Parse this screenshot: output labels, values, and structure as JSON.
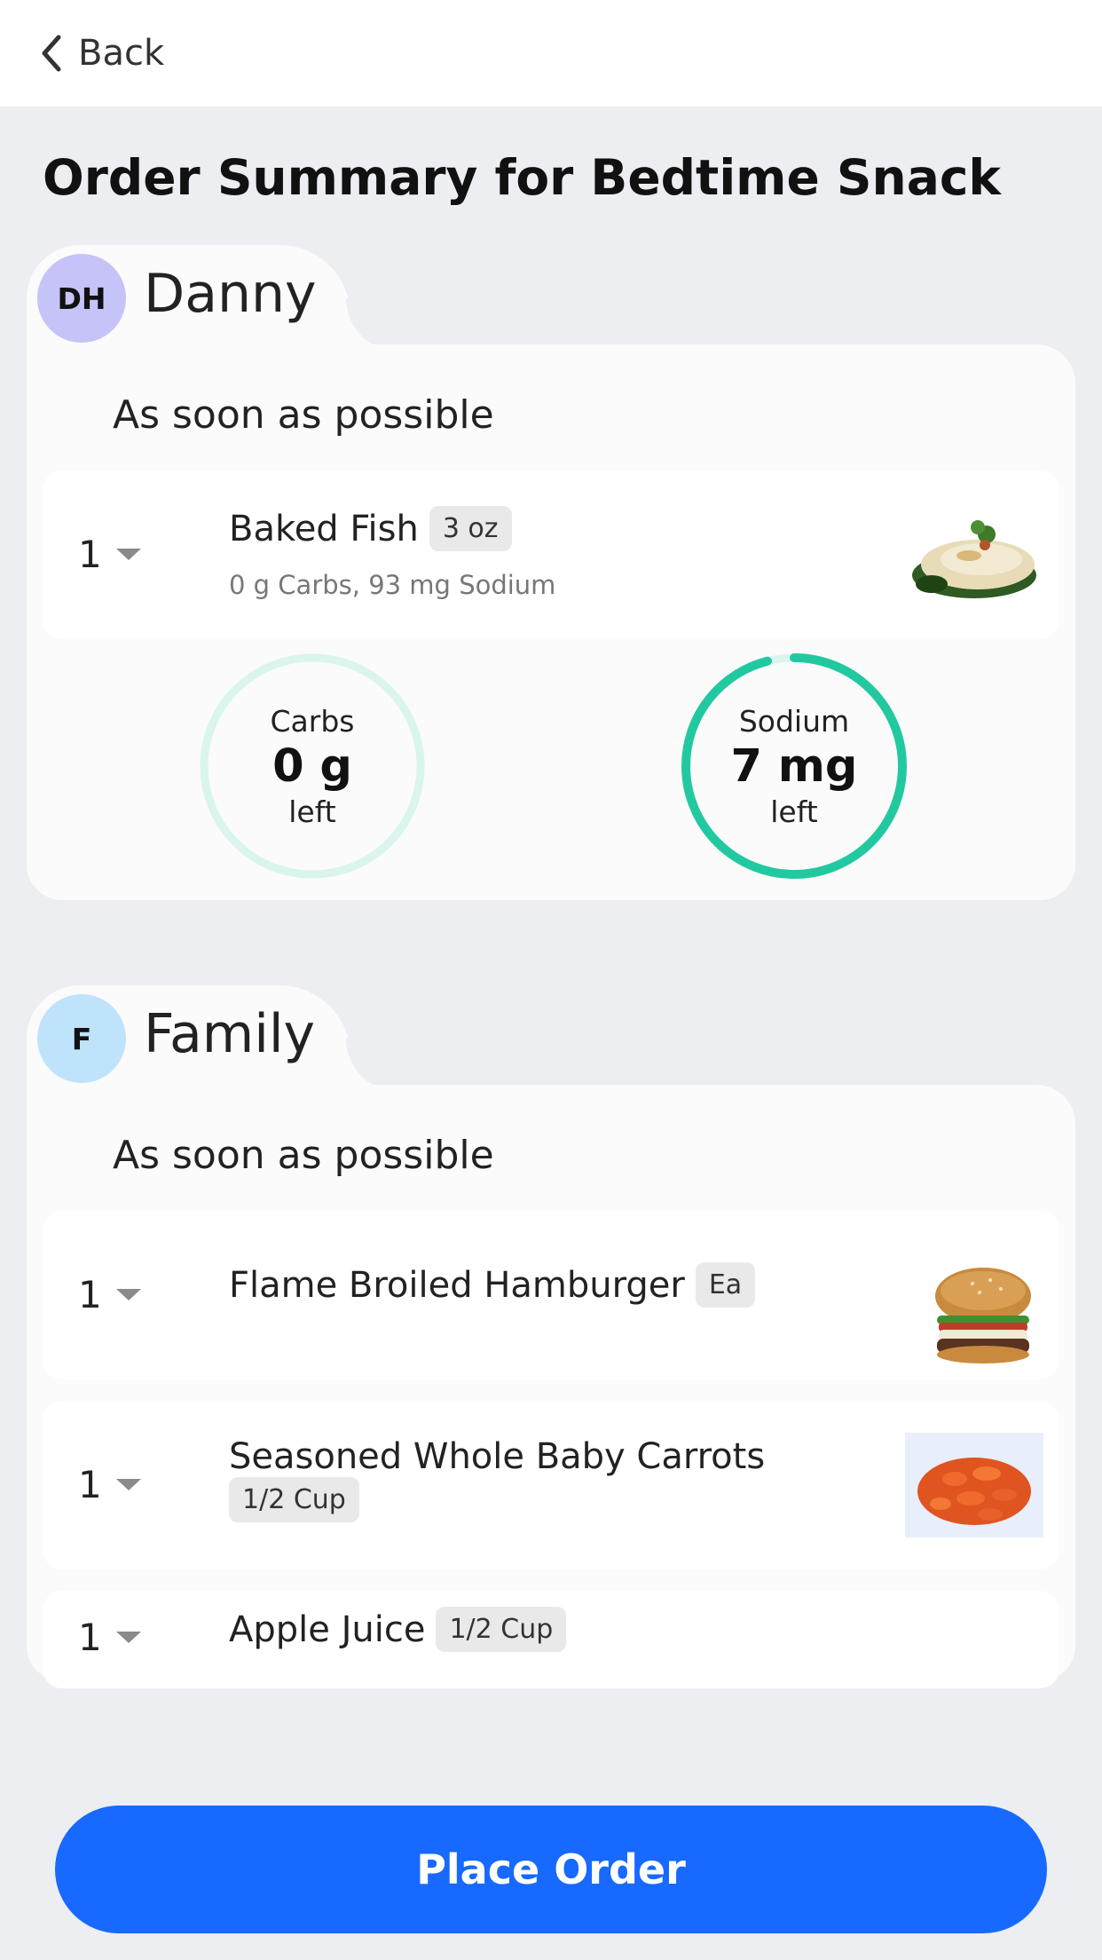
{
  "header": {
    "back_label": "Back"
  },
  "page_title": "Order Summary for Bedtime Snack",
  "colors": {
    "accent": "#1769ff",
    "ring_active": "#22c9a0",
    "ring_track": "#d9f5ee",
    "avatar_danny": "#c5c3f7",
    "avatar_family": "#bfe3fb"
  },
  "orders": [
    {
      "initials": "DH",
      "name": "Danny",
      "timing": "As soon as possible",
      "items": [
        {
          "qty": "1",
          "name": "Baked Fish",
          "portion": "3 oz",
          "nutrition": "0 g Carbs, 93 mg Sodium",
          "image": "baked-fish"
        }
      ],
      "rings": [
        {
          "label": "Carbs",
          "value": "0 g",
          "unit": "left",
          "fraction": 0.0
        },
        {
          "label": "Sodium",
          "value": "7 mg",
          "unit": "left",
          "fraction": 0.96
        }
      ]
    },
    {
      "initials": "F",
      "name": "Family",
      "timing": "As soon as possible",
      "items": [
        {
          "qty": "1",
          "name": "Flame Broiled Hamburger",
          "portion": "Ea",
          "image": "hamburger"
        },
        {
          "qty": "1",
          "name": "Seasoned Whole Baby Carrots",
          "portion": "1/2 Cup",
          "image": "carrots"
        },
        {
          "qty": "1",
          "name": "Apple Juice",
          "portion": "1/2 Cup"
        }
      ]
    }
  ],
  "footer": {
    "place_order_label": "Place Order"
  }
}
